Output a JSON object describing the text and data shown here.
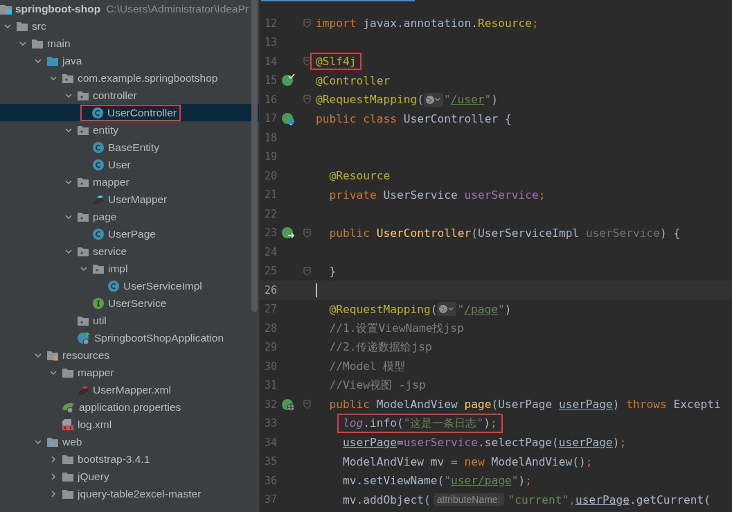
{
  "project_tree": {
    "project": "springboot-shop",
    "path": "C:\\Users\\Administrator\\IdeaPr",
    "children": [
      {
        "label": "src",
        "kind": "folder",
        "expanded": true,
        "selected": false,
        "children": [
          {
            "label": "main",
            "kind": "folder",
            "expanded": true,
            "selected": false,
            "children": [
              {
                "label": "java",
                "kind": "source-folder",
                "expanded": true,
                "selected": false,
                "children": [
                  {
                    "label": "com.example.springbootshop",
                    "kind": "package",
                    "expanded": true,
                    "selected": false,
                    "children": [
                      {
                        "label": "controller",
                        "kind": "package",
                        "expanded": true,
                        "selected": false,
                        "children": [
                          {
                            "label": "UserController",
                            "kind": "class",
                            "selected": true,
                            "boxed": true
                          }
                        ]
                      },
                      {
                        "label": "entity",
                        "kind": "package",
                        "expanded": true,
                        "selected": false,
                        "children": [
                          {
                            "label": "BaseEntity",
                            "kind": "class",
                            "selected": false
                          },
                          {
                            "label": "User",
                            "kind": "class",
                            "selected": false
                          }
                        ]
                      },
                      {
                        "label": "mapper",
                        "kind": "package",
                        "expanded": true,
                        "selected": false,
                        "children": [
                          {
                            "label": "UserMapper",
                            "kind": "mybatis",
                            "selected": false
                          }
                        ]
                      },
                      {
                        "label": "page",
                        "kind": "package",
                        "expanded": true,
                        "selected": false,
                        "children": [
                          {
                            "label": "UserPage",
                            "kind": "class",
                            "selected": false
                          }
                        ]
                      },
                      {
                        "label": "service",
                        "kind": "package",
                        "expanded": true,
                        "selected": false,
                        "children": [
                          {
                            "label": "impl",
                            "kind": "package",
                            "expanded": true,
                            "selected": false,
                            "children": [
                              {
                                "label": "UserServiceImpl",
                                "kind": "class",
                                "selected": false
                              }
                            ]
                          },
                          {
                            "label": "UserService",
                            "kind": "interface",
                            "selected": false
                          }
                        ]
                      },
                      {
                        "label": "util",
                        "kind": "package",
                        "selected": false
                      },
                      {
                        "label": "SpringbootShopApplication",
                        "kind": "spring-app",
                        "selected": false
                      }
                    ]
                  }
                ]
              },
              {
                "label": "resources",
                "kind": "resources-folder",
                "expanded": true,
                "selected": false,
                "children": [
                  {
                    "label": "mapper",
                    "kind": "folder",
                    "expanded": true,
                    "selected": false,
                    "children": [
                      {
                        "label": "UserMapper.xml",
                        "kind": "mybatis-xml",
                        "selected": false
                      }
                    ]
                  },
                  {
                    "label": "application.properties",
                    "kind": "properties",
                    "selected": false
                  },
                  {
                    "label": "log.xml",
                    "kind": "xml",
                    "selected": false
                  }
                ]
              },
              {
                "label": "web",
                "kind": "web-folder",
                "expanded": true,
                "selected": false,
                "children": [
                  {
                    "label": "bootstrap-3.4.1",
                    "kind": "folder",
                    "expanded": false,
                    "selected": false
                  },
                  {
                    "label": "jQuery",
                    "kind": "folder",
                    "expanded": false,
                    "selected": false
                  },
                  {
                    "label": "jquery-table2excel-master",
                    "kind": "folder",
                    "expanded": false,
                    "selected": false
                  }
                ]
              }
            ]
          }
        ]
      }
    ]
  },
  "editor": {
    "lines": [
      {
        "number": "12",
        "current": false,
        "fold": true,
        "tokens": [
          {
            "kind": "kw",
            "text": "import"
          },
          {
            "kind": "plain",
            "text": " javax.annotation."
          },
          {
            "kind": "ann",
            "text": "Resource"
          },
          {
            "kind": "kw",
            "text": ";"
          }
        ]
      },
      {
        "number": "13",
        "current": false
      },
      {
        "number": "14",
        "current": false,
        "fold": true,
        "boxed": true,
        "tokens": [
          {
            "kind": "ann",
            "text": "@Slf4j"
          }
        ]
      },
      {
        "number": "15",
        "current": false,
        "gutter_icon": {
          "kind": "check"
        },
        "tokens": [
          {
            "kind": "ann",
            "text": "@Controller"
          }
        ]
      },
      {
        "number": "16",
        "current": false,
        "fold": true,
        "tokens": [
          {
            "kind": "ann",
            "text": "@RequestMapping"
          },
          {
            "kind": "plain",
            "text": "("
          },
          {
            "kind": "globe"
          },
          {
            "kind": "str",
            "text": "\""
          },
          {
            "kind": "url",
            "text": "/user"
          },
          {
            "kind": "str",
            "text": "\""
          },
          {
            "kind": "plain",
            "text": ")"
          }
        ]
      },
      {
        "number": "17",
        "current": false,
        "gutter_icon": {
          "kind": "class"
        },
        "tokens": [
          {
            "kind": "kw",
            "text": "public class "
          },
          {
            "kind": "plain",
            "text": "UserController {"
          }
        ]
      },
      {
        "number": "18",
        "current": false
      },
      {
        "number": "19",
        "current": false
      },
      {
        "number": "20",
        "current": false,
        "tokens": [
          {
            "kind": "ann",
            "text": "  @Resource"
          }
        ]
      },
      {
        "number": "21",
        "current": false,
        "tokens": [
          {
            "kind": "kw",
            "text": "  private "
          },
          {
            "kind": "plain",
            "text": "UserService "
          },
          {
            "kind": "field",
            "text": "userService"
          },
          {
            "kind": "kw",
            "text": ";"
          }
        ]
      },
      {
        "number": "22",
        "current": false
      },
      {
        "number": "23",
        "current": false,
        "gutter_icon": {
          "kind": "arrow"
        },
        "fold": true,
        "tokens": [
          {
            "kind": "kw",
            "text": "  public "
          },
          {
            "kind": "fn",
            "text": "UserController"
          },
          {
            "kind": "plain",
            "text": "(UserServiceImpl "
          },
          {
            "kind": "unused",
            "text": "userService"
          },
          {
            "kind": "plain",
            "text": ") {"
          }
        ]
      },
      {
        "number": "24",
        "current": false
      },
      {
        "number": "25",
        "current": false,
        "fold": true,
        "tokens": [
          {
            "kind": "plain",
            "text": "  }"
          }
        ]
      },
      {
        "number": "26",
        "current": true
      },
      {
        "number": "27",
        "current": false,
        "tokens": [
          {
            "kind": "ann",
            "text": "  @RequestMapping"
          },
          {
            "kind": "plain",
            "text": "("
          },
          {
            "kind": "globe"
          },
          {
            "kind": "str",
            "text": "\""
          },
          {
            "kind": "url",
            "text": "/page"
          },
          {
            "kind": "str",
            "text": "\""
          },
          {
            "kind": "plain",
            "text": ")"
          }
        ]
      },
      {
        "number": "28",
        "current": false,
        "tokens": [
          {
            "kind": "comment",
            "text": "  //1.设置ViewName找jsp"
          }
        ]
      },
      {
        "number": "29",
        "current": false,
        "tokens": [
          {
            "kind": "comment",
            "text": "  //2.传递数据给jsp"
          }
        ]
      },
      {
        "number": "30",
        "current": false,
        "tokens": [
          {
            "kind": "comment",
            "text": "  //Model 模型"
          }
        ]
      },
      {
        "number": "31",
        "current": false,
        "tokens": [
          {
            "kind": "comment",
            "text": "  //View视图 -jsp"
          }
        ]
      },
      {
        "number": "32",
        "current": false,
        "gutter_icon": {
          "kind": "globe"
        },
        "fold": true,
        "tokens": [
          {
            "kind": "kw",
            "text": "  public "
          },
          {
            "kind": "plain",
            "text": "ModelAndView "
          },
          {
            "kind": "fn",
            "text": "page"
          },
          {
            "kind": "plain",
            "text": "(UserPage "
          },
          {
            "kind": "ul",
            "text": "userPage"
          },
          {
            "kind": "plain",
            "text": ") "
          },
          {
            "kind": "kw",
            "text": "throws "
          },
          {
            "kind": "plain",
            "text": "Excepti"
          }
        ]
      },
      {
        "number": "33",
        "current": false,
        "boxed": true,
        "tokens": [
          {
            "kind": "log",
            "text": "    log"
          },
          {
            "kind": "plain",
            "text": ".info("
          },
          {
            "kind": "str",
            "text": "\"这是一条日志\""
          },
          {
            "kind": "plain",
            "text": ")"
          },
          {
            "kind": "kw",
            "text": ";"
          }
        ]
      },
      {
        "number": "34",
        "current": false,
        "tokens": [
          {
            "kind": "ul",
            "text": "    userPage"
          },
          {
            "kind": "plain",
            "text": "="
          },
          {
            "kind": "field",
            "text": "userService"
          },
          {
            "kind": "plain",
            "text": ".selectPage("
          },
          {
            "kind": "ul",
            "text": "userPage"
          },
          {
            "kind": "plain",
            "text": ")"
          },
          {
            "kind": "kw",
            "text": ";"
          }
        ]
      },
      {
        "number": "35",
        "current": false,
        "tokens": [
          {
            "kind": "plain",
            "text": "    ModelAndView mv = "
          },
          {
            "kind": "kw",
            "text": "new "
          },
          {
            "kind": "plain",
            "text": "ModelAndView()"
          },
          {
            "kind": "kw",
            "text": ";"
          }
        ]
      },
      {
        "number": "36",
        "current": false,
        "tokens": [
          {
            "kind": "plain",
            "text": "    mv.setViewName("
          },
          {
            "kind": "str",
            "text": "\""
          },
          {
            "kind": "url",
            "text": "user/page"
          },
          {
            "kind": "str",
            "text": "\""
          },
          {
            "kind": "plain",
            "text": ")"
          },
          {
            "kind": "kw",
            "text": ";"
          }
        ]
      },
      {
        "number": "37",
        "current": false,
        "tokens": [
          {
            "kind": "plain",
            "text": "    mv.addObject("
          },
          {
            "kind": "hint",
            "text": "attributeName:"
          },
          {
            "kind": "str",
            "text": "\"current\","
          },
          {
            "kind": "ul",
            "text": "userPage"
          },
          {
            "kind": "plain",
            "text": ".getCurrent("
          }
        ]
      }
    ]
  }
}
